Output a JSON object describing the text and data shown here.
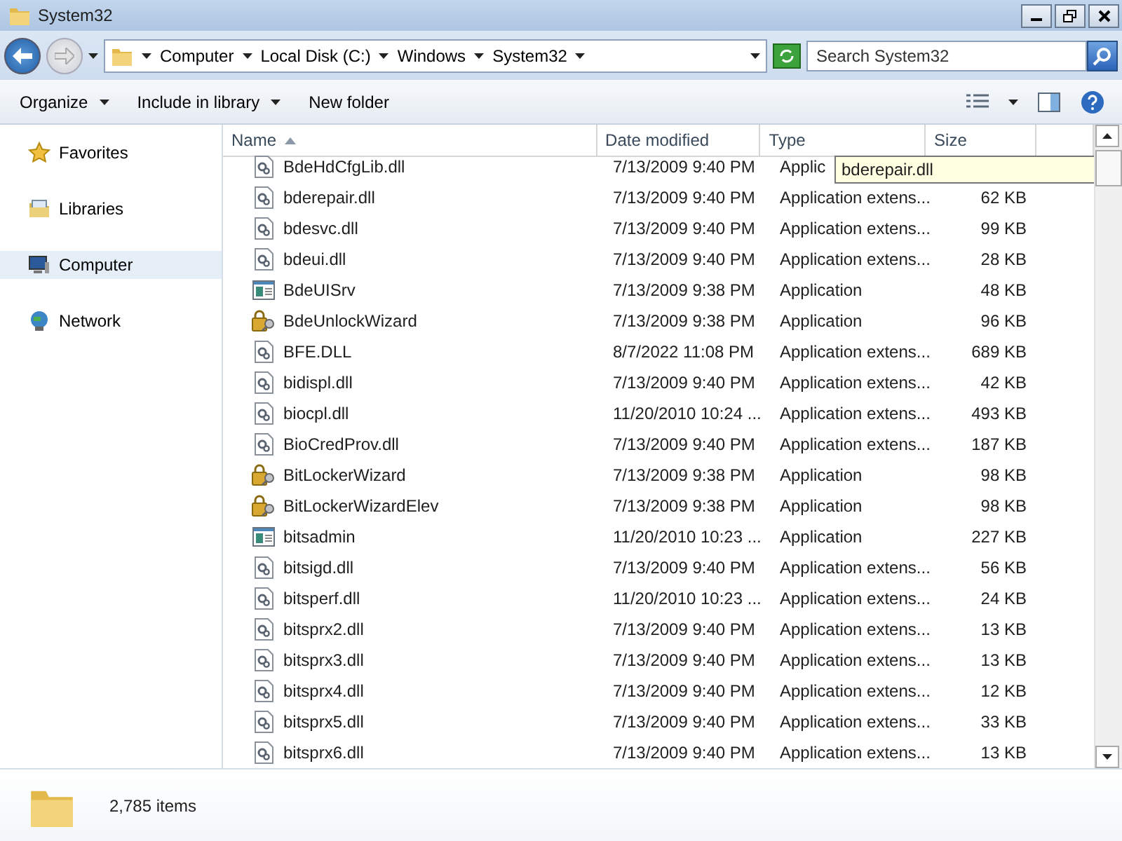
{
  "window": {
    "title": "System32"
  },
  "address": {
    "crumbs": [
      "Computer",
      "Local Disk (C:)",
      "Windows",
      "System32"
    ]
  },
  "search": {
    "placeholder": "Search System32"
  },
  "toolbar": {
    "buttons": [
      {
        "label": "Organize",
        "dropdown": true
      },
      {
        "label": "Include in library",
        "dropdown": true
      },
      {
        "label": "New folder",
        "dropdown": false
      }
    ]
  },
  "sidebar": {
    "items": [
      {
        "label": "Favorites",
        "kind": "star",
        "selected": false
      },
      {
        "label": "Libraries",
        "kind": "library",
        "selected": false
      },
      {
        "label": "Computer",
        "kind": "computer",
        "selected": true
      },
      {
        "label": "Network",
        "kind": "network",
        "selected": false
      }
    ]
  },
  "table": {
    "columns": [
      "Name",
      "Date modified",
      "Type",
      "Size"
    ],
    "rows": [
      {
        "kind": "dll",
        "name": "BdeHdCfgLib.dll",
        "date": "7/13/2009 9:40 PM",
        "type": "Applic",
        "size": ""
      },
      {
        "kind": "dll",
        "name": "bderepair.dll",
        "date": "7/13/2009 9:40 PM",
        "type": "Application extens...",
        "size": "62 KB"
      },
      {
        "kind": "dll",
        "name": "bdesvc.dll",
        "date": "7/13/2009 9:40 PM",
        "type": "Application extens...",
        "size": "99 KB"
      },
      {
        "kind": "dll",
        "name": "bdeui.dll",
        "date": "7/13/2009 9:40 PM",
        "type": "Application extens...",
        "size": "28 KB"
      },
      {
        "kind": "exe",
        "name": "BdeUISrv",
        "date": "7/13/2009 9:38 PM",
        "type": "Application",
        "size": "48 KB"
      },
      {
        "kind": "wizard",
        "name": "BdeUnlockWizard",
        "date": "7/13/2009 9:38 PM",
        "type": "Application",
        "size": "96 KB"
      },
      {
        "kind": "dll",
        "name": "BFE.DLL",
        "date": "8/7/2022 11:08 PM",
        "type": "Application extens...",
        "size": "689 KB"
      },
      {
        "kind": "dll",
        "name": "bidispl.dll",
        "date": "7/13/2009 9:40 PM",
        "type": "Application extens...",
        "size": "42 KB"
      },
      {
        "kind": "dll",
        "name": "biocpl.dll",
        "date": "11/20/2010 10:24 ...",
        "type": "Application extens...",
        "size": "493 KB"
      },
      {
        "kind": "dll",
        "name": "BioCredProv.dll",
        "date": "7/13/2009 9:40 PM",
        "type": "Application extens...",
        "size": "187 KB"
      },
      {
        "kind": "wizard",
        "name": "BitLockerWizard",
        "date": "7/13/2009 9:38 PM",
        "type": "Application",
        "size": "98 KB"
      },
      {
        "kind": "wizard",
        "name": "BitLockerWizardElev",
        "date": "7/13/2009 9:38 PM",
        "type": "Application",
        "size": "98 KB"
      },
      {
        "kind": "exe",
        "name": "bitsadmin",
        "date": "11/20/2010 10:23 ...",
        "type": "Application",
        "size": "227 KB"
      },
      {
        "kind": "dll",
        "name": "bitsigd.dll",
        "date": "7/13/2009 9:40 PM",
        "type": "Application extens...",
        "size": "56 KB"
      },
      {
        "kind": "dll",
        "name": "bitsperf.dll",
        "date": "11/20/2010 10:23 ...",
        "type": "Application extens...",
        "size": "24 KB"
      },
      {
        "kind": "dll",
        "name": "bitsprx2.dll",
        "date": "7/13/2009 9:40 PM",
        "type": "Application extens...",
        "size": "13 KB"
      },
      {
        "kind": "dll",
        "name": "bitsprx3.dll",
        "date": "7/13/2009 9:40 PM",
        "type": "Application extens...",
        "size": "13 KB"
      },
      {
        "kind": "dll",
        "name": "bitsprx4.dll",
        "date": "7/13/2009 9:40 PM",
        "type": "Application extens...",
        "size": "12 KB"
      },
      {
        "kind": "dll",
        "name": "bitsprx5.dll",
        "date": "7/13/2009 9:40 PM",
        "type": "Application extens...",
        "size": "33 KB"
      },
      {
        "kind": "dll",
        "name": "bitsprx6.dll",
        "date": "7/13/2009 9:40 PM",
        "type": "Application extens...",
        "size": "13 KB"
      }
    ]
  },
  "tooltip": {
    "text": "bderepair.dll"
  },
  "status_bar": {
    "count": "2,785 items"
  }
}
